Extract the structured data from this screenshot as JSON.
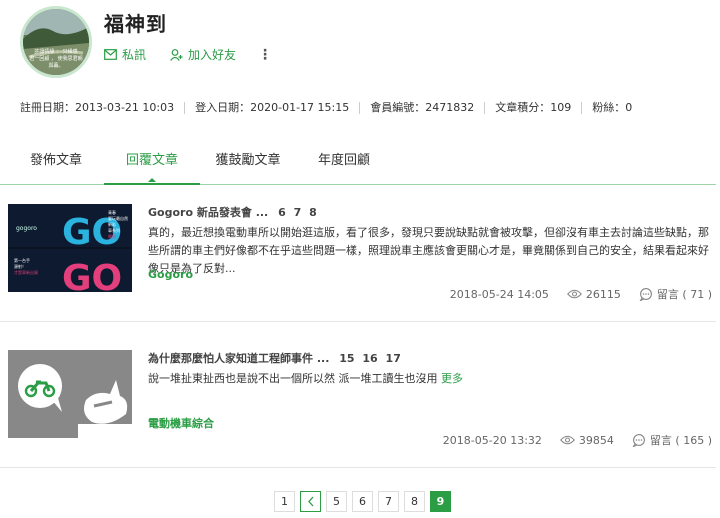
{
  "profile": {
    "username": "福神到",
    "avatar_caption_1": "許讓情緣 ： 只緣感",
    "avatar_caption_2": "君一回顧 ， 使我思君朝",
    "avatar_caption_3": "與暮。",
    "message_label": "私訊",
    "add_friend_label": "加入好友",
    "more_label": "⋮"
  },
  "stats": [
    "註冊日期：2013-03-21 10:03",
    "登入日期：2020-01-17 15:15",
    "會員編號：2471832",
    "文章積分：109",
    "粉絲：0"
  ],
  "tabs": [
    "發佈文章",
    "回覆文章",
    "獲鼓勵文章",
    "年度回顧"
  ],
  "active_tab": 1,
  "posts": [
    {
      "title": "Gogoro 新品發表會",
      "ellipsis": "...",
      "pages": [
        "6",
        "7",
        "8"
      ],
      "excerpt": "真的，最近想換電動車所以開始逛這版，看了很多，發現只要說缺點就會被攻擊，但卻沒有車主去討論這些缺點，那些所謂的車主們好像都不在乎這些問題一樣，照理說車主應該會更關心才是，畢竟關係到自己的安全，結果看起來好像只是為了反對...",
      "forum": "Gogoro",
      "time": "2018-05-24 14:05",
      "views": "26115",
      "comments": "留言 ( 71 )",
      "thumb_text_1": "GO",
      "thumb_text_2": "GO",
      "thumb_brand": "gogoro",
      "thumb_lines": [
        "青春",
        "要玩最自然",
        "新彩",
        "車系列",
        "開始"
      ],
      "thumb_lines_2": [
        "第一台手",
        "源射！",
        "才是車新出資"
      ]
    },
    {
      "title": "為什麼那麼怕人家知道工程師事件",
      "ellipsis": "...",
      "pages": [
        "15",
        "16",
        "17"
      ],
      "excerpt": "說一堆扯東扯西也是說不出一個所以然 派一堆工讀生也沒用",
      "more": "更多",
      "forum": "電動機車綜合",
      "time": "2018-05-20 13:32",
      "views": "39854",
      "comments": "留言 ( 165 )"
    }
  ],
  "pager": [
    "1",
    "5",
    "6",
    "7",
    "8",
    "9"
  ],
  "colors": {
    "accent": "#2a9d45",
    "tab_border": "#9ed3a8"
  },
  "icons": {
    "message": "envelope-icon",
    "add_friend": "person-add-icon",
    "views": "eye-icon",
    "comments": "speech-bubble-icon",
    "prev_page": "chevron-left-icon"
  }
}
